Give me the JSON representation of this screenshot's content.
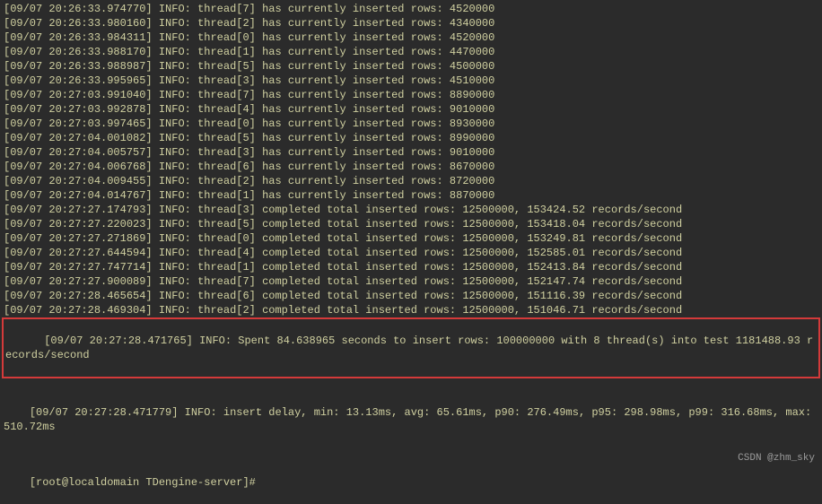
{
  "insert_lines": [
    {
      "ts": "[09/07 20:26:33.974770]",
      "lvl": "INFO:",
      "th": "thread[7]",
      "txt": "has currently inserted rows: 4520000"
    },
    {
      "ts": "[09/07 20:26:33.980160]",
      "lvl": "INFO:",
      "th": "thread[2]",
      "txt": "has currently inserted rows: 4340000"
    },
    {
      "ts": "[09/07 20:26:33.984311]",
      "lvl": "INFO:",
      "th": "thread[0]",
      "txt": "has currently inserted rows: 4520000"
    },
    {
      "ts": "[09/07 20:26:33.988170]",
      "lvl": "INFO:",
      "th": "thread[1]",
      "txt": "has currently inserted rows: 4470000"
    },
    {
      "ts": "[09/07 20:26:33.988987]",
      "lvl": "INFO:",
      "th": "thread[5]",
      "txt": "has currently inserted rows: 4500000"
    },
    {
      "ts": "[09/07 20:26:33.995965]",
      "lvl": "INFO:",
      "th": "thread[3]",
      "txt": "has currently inserted rows: 4510000"
    },
    {
      "ts": "[09/07 20:27:03.991040]",
      "lvl": "INFO:",
      "th": "thread[7]",
      "txt": "has currently inserted rows: 8890000"
    },
    {
      "ts": "[09/07 20:27:03.992878]",
      "lvl": "INFO:",
      "th": "thread[4]",
      "txt": "has currently inserted rows: 9010000"
    },
    {
      "ts": "[09/07 20:27:03.997465]",
      "lvl": "INFO:",
      "th": "thread[0]",
      "txt": "has currently inserted rows: 8930000"
    },
    {
      "ts": "[09/07 20:27:04.001082]",
      "lvl": "INFO:",
      "th": "thread[5]",
      "txt": "has currently inserted rows: 8990000"
    },
    {
      "ts": "[09/07 20:27:04.005757]",
      "lvl": "INFO:",
      "th": "thread[3]",
      "txt": "has currently inserted rows: 9010000"
    },
    {
      "ts": "[09/07 20:27:04.006768]",
      "lvl": "INFO:",
      "th": "thread[6]",
      "txt": "has currently inserted rows: 8670000"
    },
    {
      "ts": "[09/07 20:27:04.009455]",
      "lvl": "INFO:",
      "th": "thread[2]",
      "txt": "has currently inserted rows: 8720000"
    },
    {
      "ts": "[09/07 20:27:04.014767]",
      "lvl": "INFO:",
      "th": "thread[1]",
      "txt": "has currently inserted rows: 8870000"
    },
    {
      "ts": "[09/07 20:27:27.174793]",
      "lvl": "INFO:",
      "th": "thread[3]",
      "txt": "completed total inserted rows: 12500000, 153424.52 records/second"
    },
    {
      "ts": "[09/07 20:27:27.220023]",
      "lvl": "INFO:",
      "th": "thread[5]",
      "txt": "completed total inserted rows: 12500000, 153418.04 records/second"
    },
    {
      "ts": "[09/07 20:27:27.271869]",
      "lvl": "INFO:",
      "th": "thread[0]",
      "txt": "completed total inserted rows: 12500000, 153249.81 records/second"
    },
    {
      "ts": "[09/07 20:27:27.644594]",
      "lvl": "INFO:",
      "th": "thread[4]",
      "txt": "completed total inserted rows: 12500000, 152585.01 records/second"
    },
    {
      "ts": "[09/07 20:27:27.747714]",
      "lvl": "INFO:",
      "th": "thread[1]",
      "txt": "completed total inserted rows: 12500000, 152413.84 records/second"
    },
    {
      "ts": "[09/07 20:27:27.900089]",
      "lvl": "INFO:",
      "th": "thread[7]",
      "txt": "completed total inserted rows: 12500000, 152147.74 records/second"
    },
    {
      "ts": "[09/07 20:27:28.465654]",
      "lvl": "INFO:",
      "th": "thread[6]",
      "txt": "completed total inserted rows: 12500000, 151116.39 records/second"
    },
    {
      "ts": "[09/07 20:27:28.469304]",
      "lvl": "INFO:",
      "th": "thread[2]",
      "txt": "completed total inserted rows: 12500000, 151046.71 records/second"
    }
  ],
  "summary_line": {
    "ts": "[09/07 20:27:28.471765]",
    "lvl": "INFO:",
    "txt": "Spent 84.638965 seconds to insert rows: 100000000 with 8 thread(s) into test 1181488.93 records/second"
  },
  "delay_line": {
    "ts": "[09/07 20:27:28.471779]",
    "lvl": "INFO:",
    "txt": "insert delay, min: 13.13ms, avg: 65.61ms, p90: 276.49ms, p95: 298.98ms, p99: 316.68ms, max: 510.72ms"
  },
  "prompt": "[root@localdomain TDengine-server]#",
  "watermark": "CSDN @zhm_sky"
}
